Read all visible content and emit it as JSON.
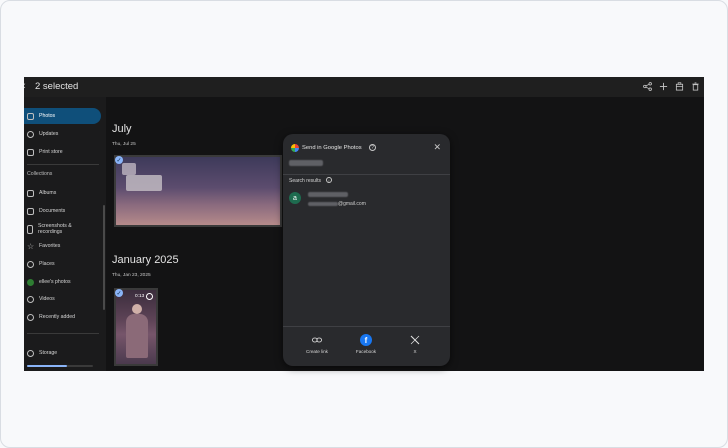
{
  "header": {
    "back_icon": "chevron-left",
    "selected_label": "2 selected",
    "actions": [
      "share-icon",
      "add-icon",
      "archive-icon",
      "delete-icon"
    ]
  },
  "sidebar": {
    "items": [
      {
        "label": "Photos",
        "icon": "photo-icon",
        "active": true
      },
      {
        "label": "Updates",
        "icon": "bell-icon"
      },
      {
        "label": "Print store",
        "icon": "bag-icon"
      }
    ],
    "collections_label": "Collections",
    "collections": [
      {
        "label": "Albums",
        "icon": "album-icon"
      },
      {
        "label": "Documents",
        "icon": "document-icon"
      },
      {
        "label": "Screenshots & recordings",
        "icon": "phone-icon"
      },
      {
        "label": "Favorites",
        "icon": "star-icon"
      },
      {
        "label": "Places",
        "icon": "pin-icon"
      },
      {
        "label": "ellee's photos",
        "icon": "avatar-icon"
      },
      {
        "label": "Videos",
        "icon": "play-icon"
      },
      {
        "label": "Recently added",
        "icon": "clock-icon"
      }
    ],
    "storage_label": "Storage"
  },
  "main": {
    "groups": [
      {
        "month": "July",
        "date": "Thu, Jul 25"
      },
      {
        "month": "January 2025",
        "date": "Thu, Jan 23, 2025",
        "video_duration": "0:13"
      }
    ]
  },
  "dialog": {
    "title": "Send in Google Photos",
    "search_results_label": "Search results",
    "result": {
      "avatar_letter": "a",
      "email_suffix": "@gmail.com"
    },
    "share_options": [
      {
        "label": "Create link",
        "icon": "link-icon"
      },
      {
        "label": "Facebook",
        "icon": "facebook-icon"
      },
      {
        "label": "X",
        "icon": "x-icon"
      }
    ]
  },
  "colors": {
    "app_bg": "#131314",
    "sidebar_active": "#0f4f7a",
    "dialog_bg": "#292a2d",
    "accent": "#8ab4f8",
    "facebook": "#1877f2"
  }
}
